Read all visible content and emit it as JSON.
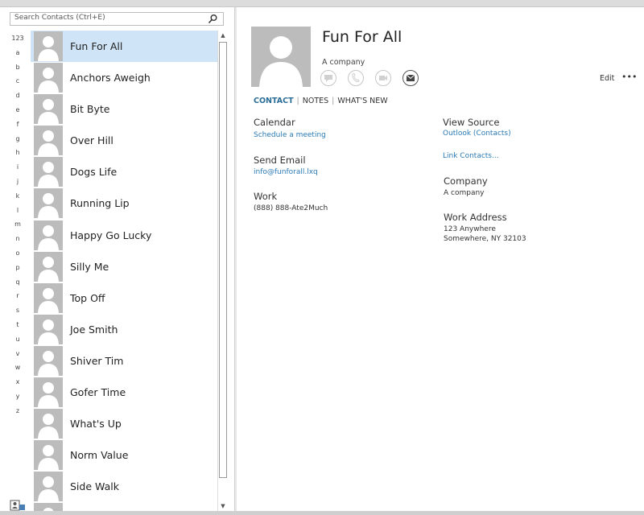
{
  "search": {
    "placeholder": "Search Contacts (Ctrl+E)"
  },
  "alphabet": [
    "123",
    "a",
    "b",
    "c",
    "d",
    "e",
    "f",
    "g",
    "h",
    "i",
    "j",
    "k",
    "l",
    "m",
    "n",
    "o",
    "p",
    "q",
    "r",
    "s",
    "t",
    "u",
    "v",
    "w",
    "x",
    "y",
    "z"
  ],
  "contacts": [
    "Fun For All",
    "Anchors Aweigh",
    "Bit Byte",
    "Over Hill",
    "Dogs Life",
    "Running Lip",
    "Happy Go Lucky",
    "Silly Me",
    "Top Off",
    "Joe Smith",
    "Shiver Tim",
    "Gofer Time",
    "What's Up",
    "Norm Value",
    "Side Walk",
    ""
  ],
  "selected_index": 0,
  "detail": {
    "name": "Fun For All",
    "company_sub": "A company",
    "edit_label": "Edit",
    "more_label": "•••",
    "tabs": [
      "CONTACT",
      "NOTES",
      "WHAT'S NEW"
    ],
    "calendar_label": "Calendar",
    "calendar_link": "Schedule a meeting",
    "email_label": "Send Email",
    "email_value": "info@funforall.lxq",
    "work_label": "Work",
    "work_value": "(888) 888-Ate2Much",
    "source_label": "View Source",
    "source_link": "Outlook (Contacts)",
    "link_contacts": "Link Contacts...",
    "company_label": "Company",
    "company_value": "A company",
    "address_label": "Work Address",
    "address_line1": "123 Anywhere",
    "address_line2": "Somewhere, NY  32103"
  },
  "colors": {
    "accent": "#2b7ab5",
    "selected": "#cfe5f7",
    "avatar_bg": "#bcbcbc"
  }
}
